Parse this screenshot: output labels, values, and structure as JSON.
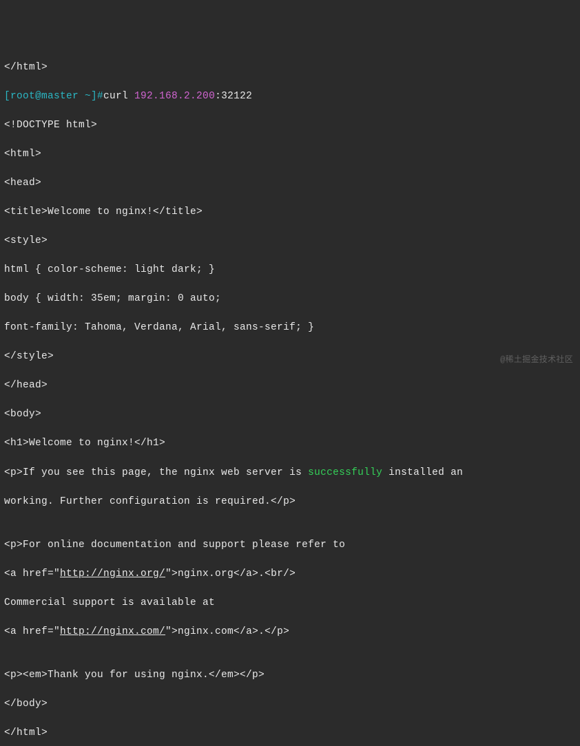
{
  "prompt": {
    "prefix": "[root@master ~]#",
    "command": "curl ",
    "ip": "192.168.2.200",
    "port": ":32122"
  },
  "lines": {
    "l00": "</html>",
    "l01": "<!DOCTYPE html>",
    "l02": "<html>",
    "l03": "<head>",
    "l04": "<title>Welcome to nginx!</title>",
    "l05": "<style>",
    "l06": "html { color-scheme: light dark; }",
    "l07": "body { width: 35em; margin: 0 auto;",
    "l08": "font-family: Tahoma, Verdana, Arial, sans-serif; }",
    "l09": "</style>",
    "l10": "</head>",
    "l11": "<body>",
    "l12": "<h1>Welcome to nginx!</h1>",
    "l13a": "<p>If you see this page, the nginx web server is ",
    "l13b": "successfully",
    "l13c": " installed an",
    "l14": "working. Further configuration is required.</p>",
    "l15": "",
    "l16": "<p>For online documentation and support please refer to",
    "l17a": "<a href=\"",
    "l17b": "http://nginx.org/",
    "l17c": "\">nginx.org</a>.<br/>",
    "l18": "Commercial support is available at",
    "l19a": "<a href=\"",
    "l19b": "http://nginx.com/",
    "l19c": "\">nginx.com</a>.</p>",
    "l20": "",
    "l21": "<p><em>Thank you for using nginx.</em></p>",
    "l22": "</body>",
    "l23": "</html>"
  },
  "watermark": "@稀土掘金技术社区"
}
